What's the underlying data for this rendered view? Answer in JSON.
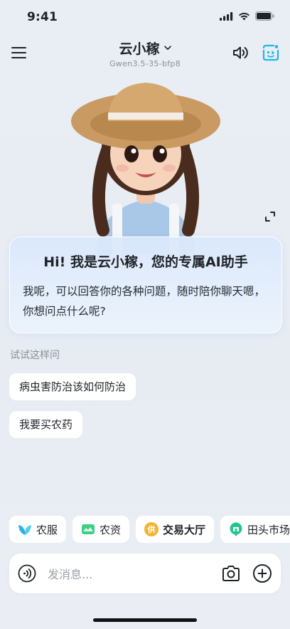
{
  "status_bar": {
    "time": "9:41"
  },
  "header": {
    "title": "云小稼",
    "subtitle": "Gwen3.5-35-bfp8"
  },
  "greeting": {
    "title": "Hi! 我是云小稼，您的专属AI助手",
    "body": "我呢，可以回答你的各种问题，随时陪你聊天嗯，你想问点什么呢?"
  },
  "suggestions": {
    "hint": "试试这样问",
    "items": [
      "病虫害防治该如何防治",
      "我要买农药"
    ]
  },
  "quick_tags": [
    {
      "label": "农服",
      "icon": "leaf-icon",
      "color": "#2bb3e8"
    },
    {
      "label": "农资",
      "icon": "field-icon",
      "color": "#3ccf86"
    },
    {
      "label": "交易大厅",
      "icon": "trade-badge-icon",
      "icon_text": "供",
      "color": "#f5b331"
    },
    {
      "label": "田头市场",
      "icon": "market-pin-icon",
      "color": "#24c48f"
    }
  ],
  "input": {
    "placeholder": "发消息..."
  },
  "colors": {
    "accent": "#1fb6e6",
    "background": "#e9eef5"
  }
}
